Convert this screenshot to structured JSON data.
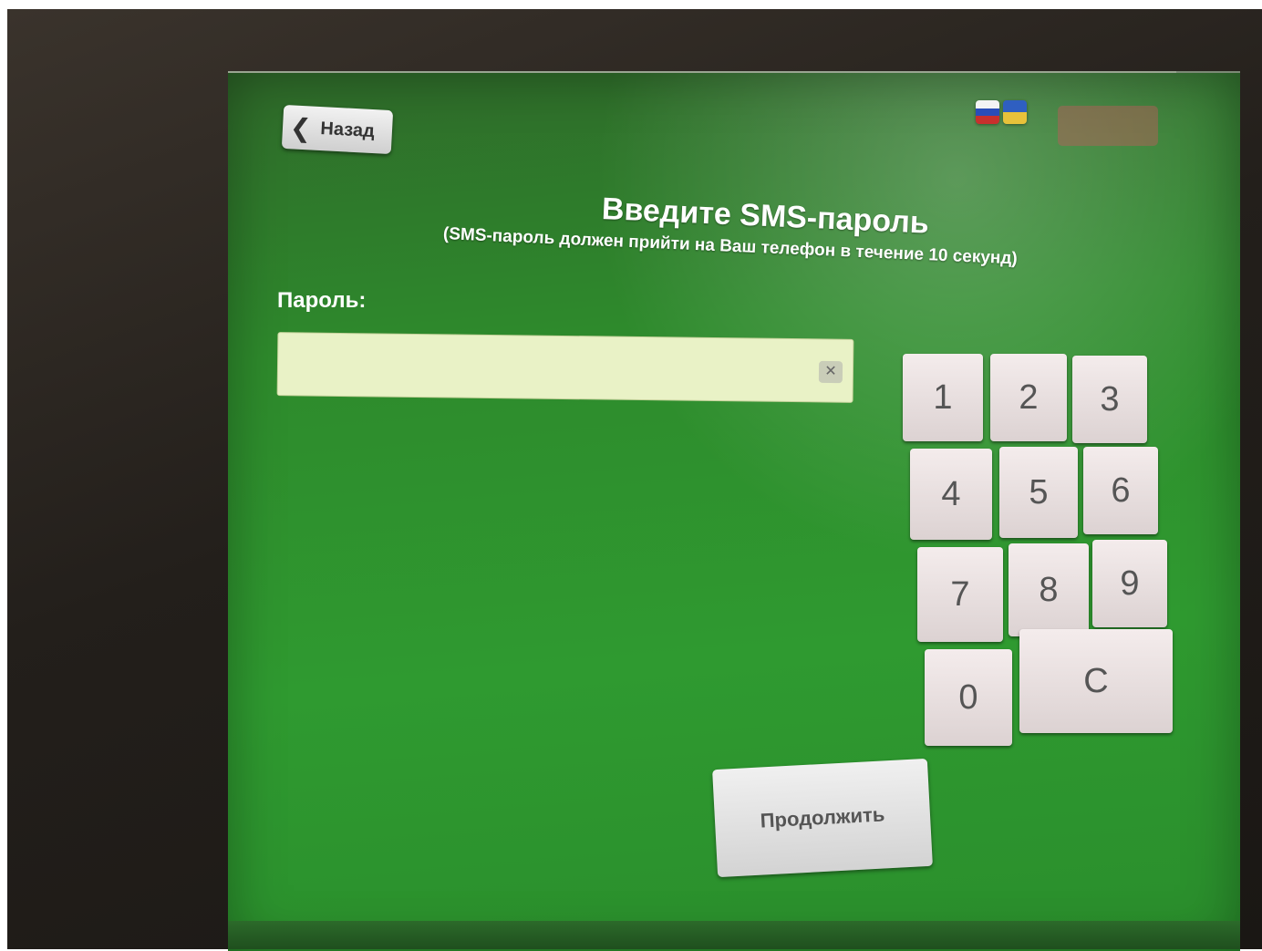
{
  "header": {
    "back_label": "Назад"
  },
  "main": {
    "title": "Введите SMS-пароль",
    "subtitle": "(SMS-пароль должен прийти на Ваш телефон в течение 10 секунд)",
    "password_label": "Пароль:",
    "password_value": "",
    "clear_icon": "✕"
  },
  "keypad": {
    "keys": [
      "1",
      "2",
      "3",
      "4",
      "5",
      "6",
      "7",
      "8",
      "9",
      "0"
    ],
    "clear_label": "C"
  },
  "continue_label": "Продолжить",
  "colors": {
    "screen_green": "#2e8a2c",
    "input_bg": "#e9f2c6",
    "key_bg": "#ece3e3"
  }
}
